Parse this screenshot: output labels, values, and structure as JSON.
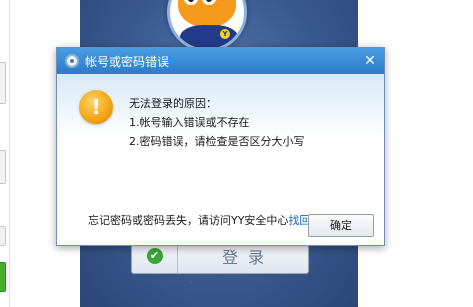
{
  "dialog": {
    "title": "帐号或密码错误",
    "close_symbol": "✕",
    "warning_symbol": "!",
    "heading": "无法登录的原因：",
    "reasons": [
      "1.帐号输入错误或不存在",
      "2.密码错误，请检查是否区分大小写"
    ],
    "footer_text": "忘记密码或密码丢失，请访问YY安全中心",
    "footer_link": "找回密码",
    "ok_label": "确定"
  },
  "login": {
    "button_label": "登录",
    "check_symbol": "✔",
    "badge_letter": "Y"
  },
  "colors": {
    "titlebar": "#3a8dd8",
    "link": "#1666b6",
    "warning": "#f3a412",
    "background": "#3b5a90"
  }
}
